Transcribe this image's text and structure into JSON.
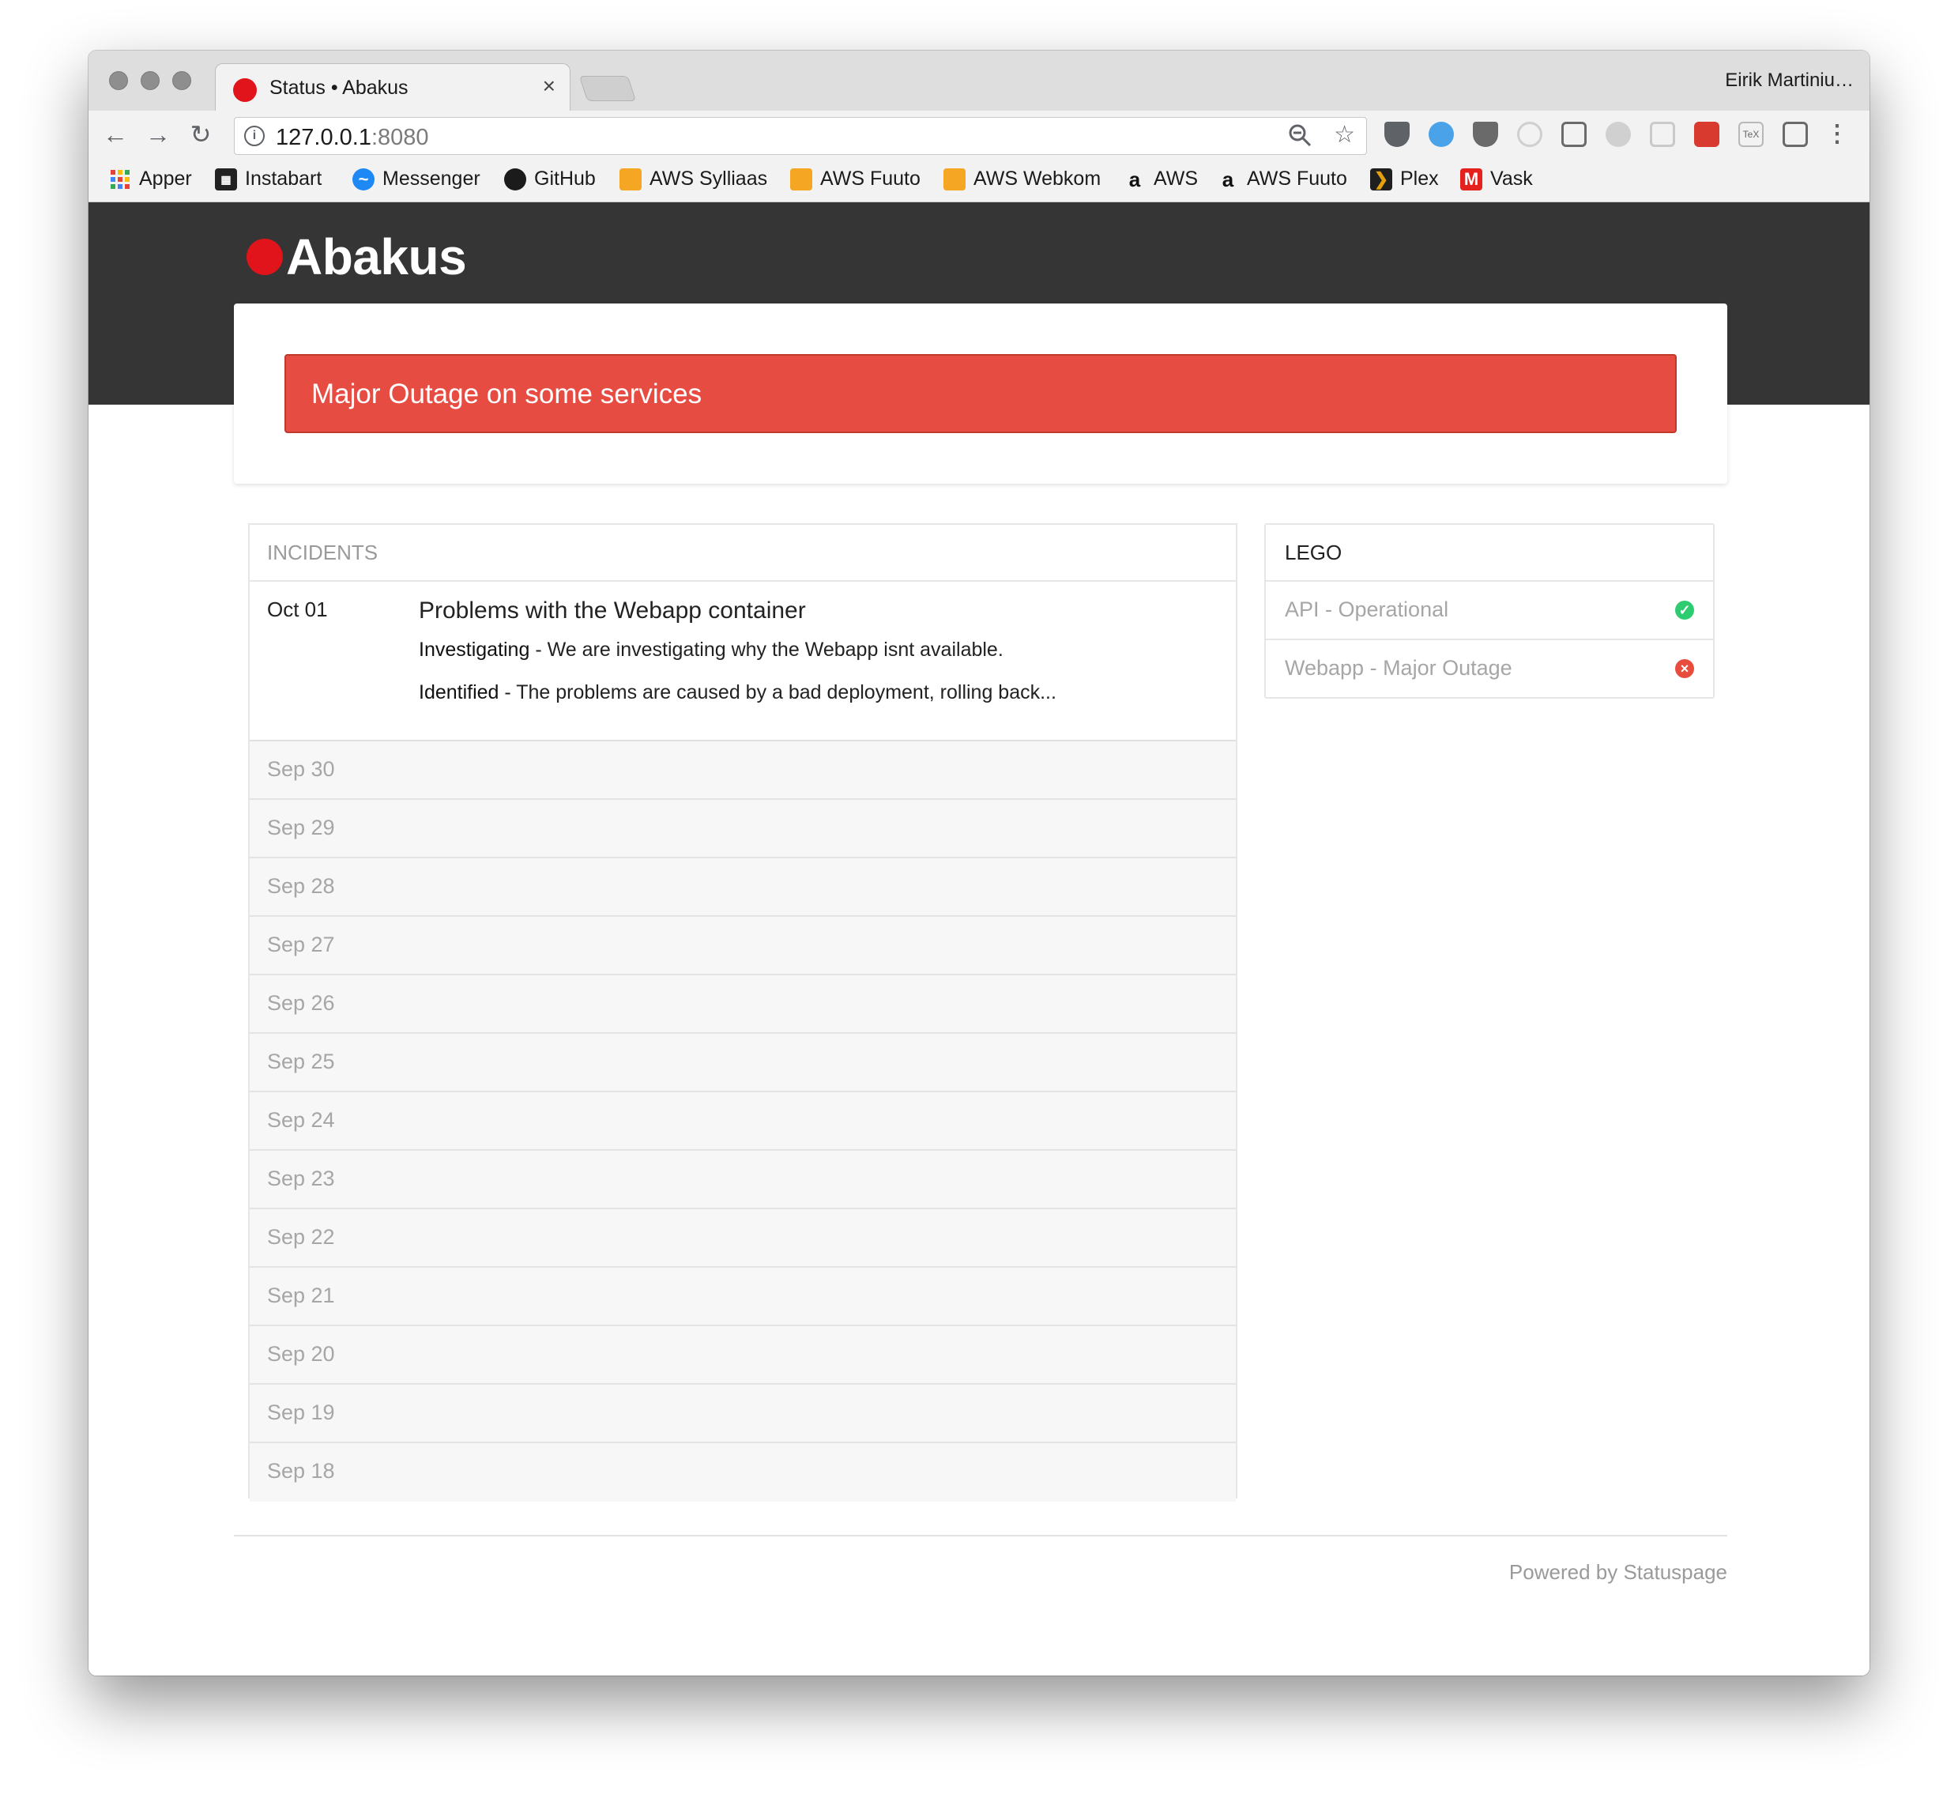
{
  "browser": {
    "tab_title": "Status • Abakus",
    "tab_close": "×",
    "profile_name": "Eirik Martiniu…",
    "url_host": "127.0.0.1",
    "url_port": ":8080",
    "bookmarks": [
      {
        "label": "Apper",
        "icon": "apps-grid-icon"
      },
      {
        "label": "Instabart",
        "icon": "instabart-icon"
      },
      {
        "label": "Messenger",
        "icon": "messenger-icon"
      },
      {
        "label": "GitHub",
        "icon": "github-icon"
      },
      {
        "label": "AWS Sylliaas",
        "icon": "aws-box-icon"
      },
      {
        "label": "AWS Fuuto",
        "icon": "aws-box-icon"
      },
      {
        "label": "AWS Webkom",
        "icon": "aws-box-icon"
      },
      {
        "label": "AWS",
        "icon": "amazon-icon"
      },
      {
        "label": "AWS Fuuto",
        "icon": "amazon-icon"
      },
      {
        "label": "Plex",
        "icon": "plex-icon"
      },
      {
        "label": "Vask",
        "icon": "gmail-icon"
      }
    ]
  },
  "site": {
    "brand": "Abakus",
    "status_message": "Major Outage on some services",
    "incidents_heading": "INCIDENTS",
    "active_incident": {
      "date": "Oct 01",
      "title": "Problems with the Webapp container",
      "updates": [
        {
          "status": "Investigating",
          "text": " - We are investigating why the Webapp isnt available."
        },
        {
          "status": "Identified",
          "text": " - The problems are caused by a bad deployment, rolling back..."
        }
      ]
    },
    "past_days": [
      "Sep 30",
      "Sep 29",
      "Sep 28",
      "Sep 27",
      "Sep 26",
      "Sep 25",
      "Sep 24",
      "Sep 23",
      "Sep 22",
      "Sep 21",
      "Sep 20",
      "Sep 19",
      "Sep 18"
    ],
    "components_heading": "LEGO",
    "components": [
      {
        "label": "API - Operational",
        "status": "operational",
        "color": "#2ecc71"
      },
      {
        "label": "Webapp - Major Outage",
        "status": "major-outage",
        "color": "#e74c3c"
      }
    ],
    "footer": "Powered by Statuspage"
  },
  "colors": {
    "brand_red": "#e0141a",
    "outage_red": "#e74c43",
    "header_dark": "#353535"
  }
}
